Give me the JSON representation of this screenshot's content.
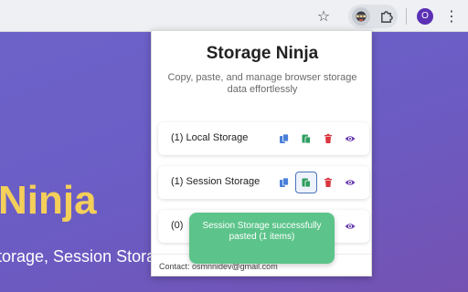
{
  "browser": {
    "star_icon": "star-icon",
    "extension_icon": "storage-ninja-extension-icon",
    "puzzle_icon": "extensions-puzzle-icon",
    "profile_initial": "O",
    "menu_icon": "⋮"
  },
  "page": {
    "hero_title": "Ninja",
    "hero_subtitle": "torage, Session Stora",
    "colors": {
      "gradient_start": "#6c63c9",
      "gradient_end": "#7452b2",
      "hero_title": "#f4cf5a"
    }
  },
  "popup": {
    "title": "Storage Ninja",
    "description": "Copy, paste, and manage browser storage data effortlessly",
    "rows": [
      {
        "label": "(1) Local Storage",
        "copy_icon": "copy-icon",
        "paste_icon": "paste-icon",
        "delete_icon": "trash-icon",
        "view_icon": "eye-icon"
      },
      {
        "label": "(1) Session Storage",
        "copy_icon": "copy-icon",
        "paste_icon": "paste-icon",
        "delete_icon": "trash-icon",
        "view_icon": "eye-icon",
        "active": "paste"
      },
      {
        "label": "(0)",
        "view_icon": "eye-icon"
      }
    ],
    "footer": "Contact: osmnnidev@gmail.com",
    "colors": {
      "copy": "#4a7fd8",
      "paste": "#2f9e60",
      "delete": "#d9363e",
      "view": "#6b3fb0"
    }
  },
  "toast": {
    "message": "Session Storage successfully pasted (1 items)",
    "color": "#5cc48a"
  }
}
